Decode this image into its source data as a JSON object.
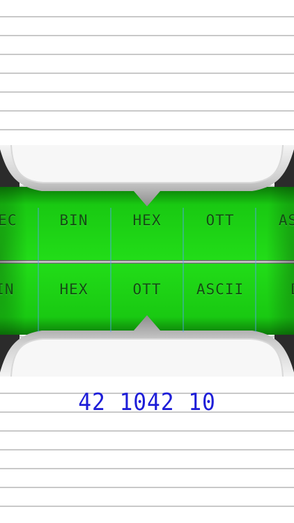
{
  "converter": {
    "source_wheel": {
      "items": [
        "DEC",
        "BIN",
        "HEX",
        "OTT",
        "ASCII"
      ],
      "selected": "HEX"
    },
    "target_wheel": {
      "items": [
        "BIN",
        "HEX",
        "OTT",
        "ASCII",
        "DEC"
      ],
      "selected": "OTT"
    },
    "result": "42 1042 10"
  },
  "colors": {
    "lcd_green": "#16d010",
    "lcd_text": "#144c14",
    "result_text": "#1e1ed8",
    "rule_line": "#c9c9c9"
  }
}
